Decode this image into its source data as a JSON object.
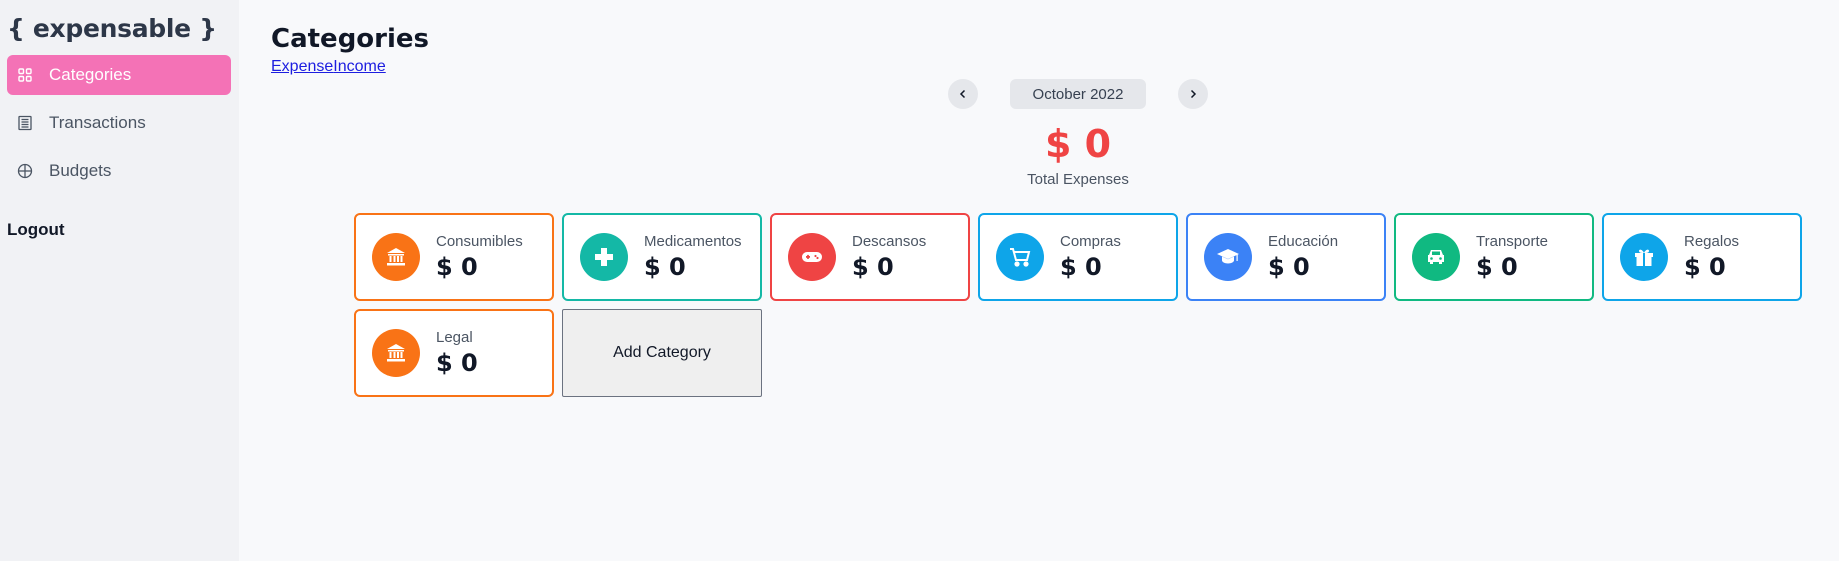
{
  "app": {
    "logo": "{ expensable }"
  },
  "sidebar": {
    "items": [
      {
        "label": "Categories",
        "icon": "grid-icon",
        "active": true
      },
      {
        "label": "Transactions",
        "icon": "receipt-icon",
        "active": false
      },
      {
        "label": "Budgets",
        "icon": "target-icon",
        "active": false
      }
    ],
    "logout_label": "Logout"
  },
  "header": {
    "title": "Categories",
    "tab_expense": "Expense",
    "tab_income": "Income"
  },
  "period": {
    "label": "October 2022",
    "prev_icon": "chevron-left-icon",
    "next_icon": "chevron-right-icon"
  },
  "summary": {
    "amount": "$ 0",
    "label": "Total Expenses",
    "color": "#ef4444"
  },
  "categories": [
    {
      "name": "Consumibles",
      "amount": "$ 0",
      "color": "#f97316",
      "icon": "bank-icon"
    },
    {
      "name": "Medicamentos",
      "amount": "$ 0",
      "color": "#14b8a6",
      "icon": "medical-cross-icon"
    },
    {
      "name": "Descansos",
      "amount": "$ 0",
      "color": "#ef4444",
      "icon": "gamepad-icon"
    },
    {
      "name": "Compras",
      "amount": "$ 0",
      "color": "#0ea5e9",
      "icon": "shopping-cart-icon"
    },
    {
      "name": "Educación",
      "amount": "$ 0",
      "color": "#3b82f6",
      "icon": "graduation-cap-icon"
    },
    {
      "name": "Transporte",
      "amount": "$ 0",
      "color": "#10b981",
      "icon": "car-icon"
    },
    {
      "name": "Regalos",
      "amount": "$ 0",
      "color": "#0ea5e9",
      "icon": "gift-icon"
    },
    {
      "name": "Legal",
      "amount": "$ 0",
      "color": "#f97316",
      "icon": "bank-icon"
    }
  ],
  "add_category_label": "Add Category"
}
